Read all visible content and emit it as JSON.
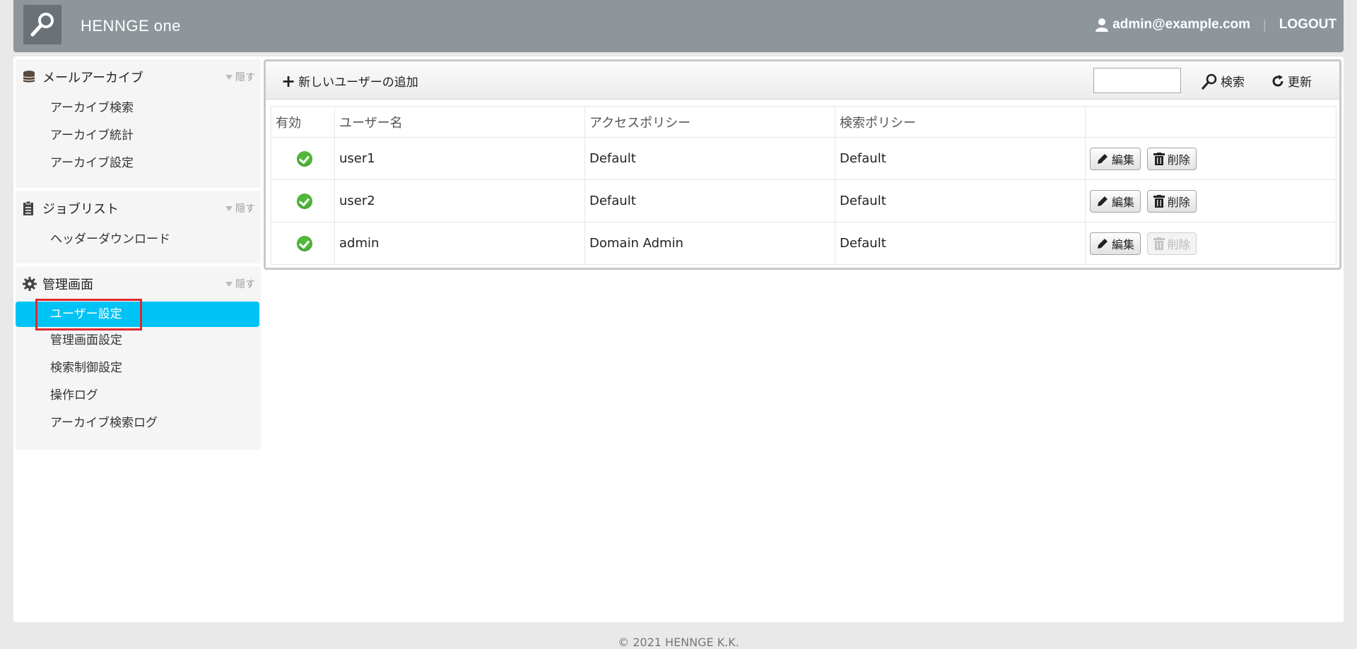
{
  "header": {
    "brand": "HENNGE one",
    "user_email": "admin@example.com",
    "logout_label": "LOGOUT"
  },
  "sidebar": {
    "hide_label": "隠す",
    "sections": [
      {
        "title": "メールアーカイブ",
        "icon": "database-icon",
        "items": [
          "アーカイブ検索",
          "アーカイブ統計",
          "アーカイブ設定"
        ]
      },
      {
        "title": "ジョブリスト",
        "icon": "clipboard-icon",
        "items": [
          "ヘッダーダウンロード"
        ]
      },
      {
        "title": "管理画面",
        "icon": "gear-icon",
        "items": [
          "ユーザー設定",
          "管理画面設定",
          "検索制御設定",
          "操作ログ",
          "アーカイブ検索ログ"
        ],
        "active_item": "ユーザー設定"
      }
    ]
  },
  "toolbar": {
    "add_user_label": "新しいユーザーの追加",
    "search_value": "",
    "search_label": "検索",
    "refresh_label": "更新"
  },
  "table": {
    "columns": [
      "有効",
      "ユーザー名",
      "アクセスポリシー",
      "検索ポリシー",
      ""
    ],
    "edit_label": "編集",
    "delete_label": "削除",
    "rows": [
      {
        "enabled": true,
        "username": "user1",
        "access_policy": "Default",
        "search_policy": "Default",
        "delete_enabled": true
      },
      {
        "enabled": true,
        "username": "user2",
        "access_policy": "Default",
        "search_policy": "Default",
        "delete_enabled": true
      },
      {
        "enabled": true,
        "username": "admin",
        "access_policy": "Domain Admin",
        "search_policy": "Default",
        "delete_enabled": false
      }
    ]
  },
  "footer": {
    "copyright": "© 2021 HENNGE K.K."
  },
  "colors": {
    "header_bg": "#8e969c",
    "active_item_bg": "#00c3f5",
    "highlight_outline": "#e0282a",
    "enabled_check": "#51b83a"
  }
}
